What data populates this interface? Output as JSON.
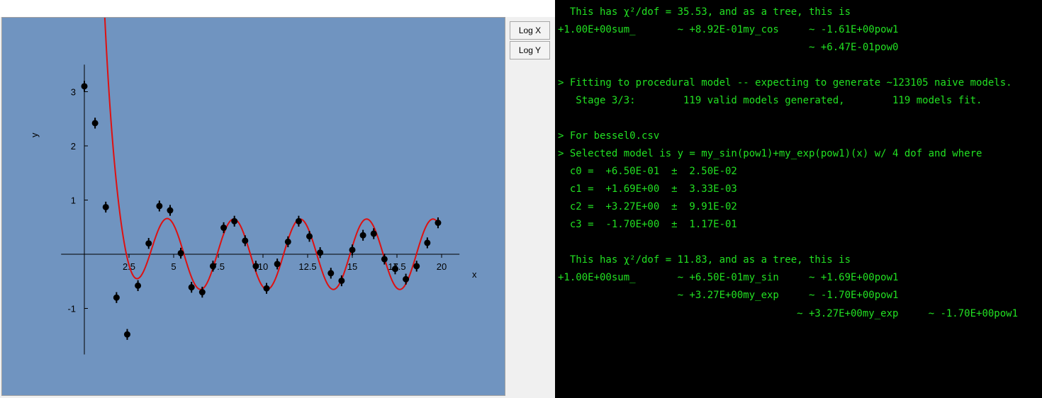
{
  "toolbar": {
    "logx_label": "Log X",
    "logy_label": "Log Y"
  },
  "chart_data": {
    "type": "scatter",
    "xlabel": "x",
    "ylabel": "y",
    "xlim": [
      -1.3,
      21
    ],
    "ylim": [
      -1.85,
      3.5
    ],
    "x_ticks": [
      2.5,
      5,
      7.5,
      10,
      12.5,
      15,
      17.5,
      20
    ],
    "x_tick_labels": [
      "2.5",
      "5",
      "7.5",
      "10",
      "12.5",
      "15",
      "17.5",
      "20"
    ],
    "y_ticks": [
      -1,
      1,
      2,
      3
    ],
    "y_tick_labels": [
      "-1",
      "1",
      "2",
      "3"
    ],
    "grid": false,
    "colors": {
      "background": "#7094c0",
      "points": "#000000",
      "fit_curve": "#dd1111"
    },
    "series": [
      {
        "kind": "points_with_error_bars",
        "x": [
          0.0,
          0.6,
          1.2,
          1.8,
          2.4,
          3.0,
          3.6,
          4.2,
          4.8,
          5.4,
          6.0,
          6.6,
          7.2,
          7.8,
          8.4,
          9.0,
          9.6,
          10.2,
          10.8,
          11.4,
          12.0,
          12.6,
          13.2,
          13.8,
          14.4,
          15.0,
          15.6,
          16.2,
          16.8,
          17.4,
          18.0,
          18.6,
          19.2,
          19.8
        ],
        "y": [
          3.1,
          2.42,
          0.87,
          -0.8,
          -1.48,
          -0.58,
          0.2,
          0.89,
          0.81,
          0.02,
          -0.61,
          -0.7,
          -0.22,
          0.49,
          0.61,
          0.25,
          -0.22,
          -0.63,
          -0.18,
          0.23,
          0.61,
          0.33,
          0.03,
          -0.35,
          -0.49,
          0.08,
          0.35,
          0.38,
          -0.09,
          -0.27,
          -0.46,
          -0.22,
          0.21,
          0.58
        ],
        "yerr": 0.1
      },
      {
        "kind": "fit_curve",
        "model": "y = c0*sin(c1*x) + exp(c2 + c3*x)",
        "params": [
          0.65,
          1.69,
          3.27,
          -1.7
        ],
        "x_range": [
          0.0,
          19.8
        ]
      }
    ]
  },
  "terminal": {
    "lines": [
      "  This has χ²/dof = 35.53, and as a tree, this is",
      "+1.00E+00sum_       ~ +8.92E-01my_cos     ~ -1.61E+00pow1",
      "                                          ~ +6.47E-01pow0",
      "",
      "> Fitting to procedural model -- expecting to generate ~123105 naive models.",
      "   Stage 3/3:        119 valid models generated,        119 models fit.",
      "",
      "> For bessel0.csv",
      "> Selected model is y = my_sin(pow1)+my_exp(pow1)(x) w/ 4 dof and where",
      "  c0 =  +6.50E-01  ±  2.50E-02",
      "  c1 =  +1.69E+00  ±  3.33E-03",
      "  c2 =  +3.27E+00  ±  9.91E-02",
      "  c3 =  -1.70E+00  ±  1.17E-01",
      "",
      "  This has χ²/dof = 11.83, and as a tree, this is",
      "+1.00E+00sum_       ~ +6.50E-01my_sin     ~ +1.69E+00pow1",
      "                    ~ +3.27E+00my_exp     ~ -1.70E+00pow1",
      "                                        ~ +3.27E+00my_exp     ~ -1.70E+00pow1"
    ]
  }
}
